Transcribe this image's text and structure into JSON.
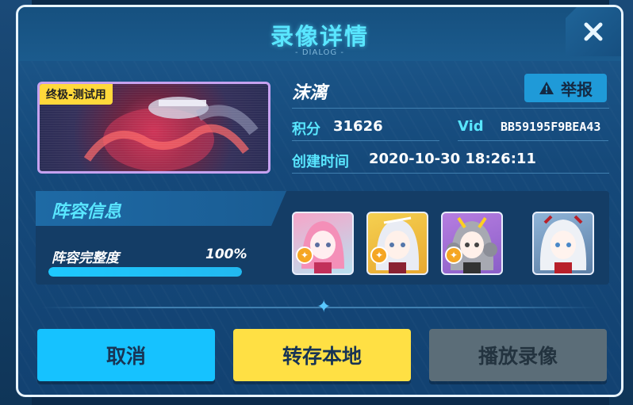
{
  "dialog": {
    "title": "录像详情",
    "subtitle": "- DIALOG -",
    "close_icon": "close-icon"
  },
  "replay": {
    "mode_tag": "终极-测试用",
    "player_name": "沫漓",
    "report_label": "举报",
    "report_icon": "warning-icon",
    "score_label": "积分",
    "score_value": "31626",
    "vid_label": "Vid",
    "vid_value": "BB59195F9BEA43",
    "created_label": "创建时间",
    "created_value": "2020-10-30 18:26:11"
  },
  "lineup": {
    "title": "阵容信息",
    "completeness_label": "阵容完整度",
    "completeness_value": "100%",
    "completeness_fraction": 1.0,
    "characters": [
      {
        "name": "character-1",
        "has_badge": true
      },
      {
        "name": "character-2",
        "has_badge": true
      },
      {
        "name": "character-3",
        "has_badge": true
      },
      {
        "name": "character-4",
        "has_badge": false
      }
    ]
  },
  "buttons": {
    "cancel": "取消",
    "save_local": "转存本地",
    "play": "播放录像"
  },
  "colors": {
    "accent_cyan": "#59e6ff",
    "cancel_btn": "#16c2ff",
    "save_btn": "#ffe044",
    "play_btn": "#5b6d78",
    "report_btn": "#1f9ad8",
    "mode_tag": "#ffd93b"
  }
}
